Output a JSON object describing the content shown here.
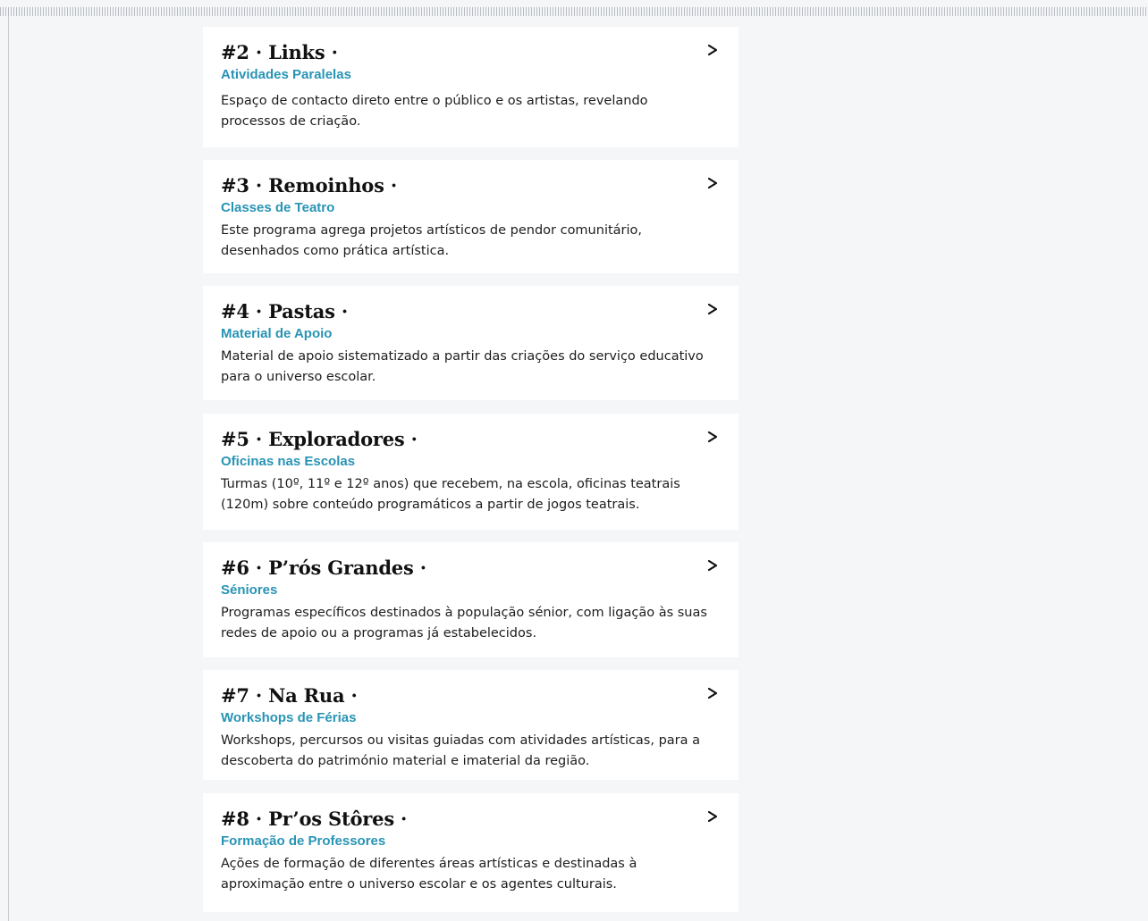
{
  "cards": [
    {
      "title": "#2 · Links ·",
      "subtitle": "Atividades Paralelas",
      "description": "Espaço de contacto direto entre o público e os artistas, revelando processos de criação."
    },
    {
      "title": "#3 · Remoinhos ·",
      "subtitle": "Classes de Teatro",
      "description": "Este programa agrega projetos artísticos de pendor comunitário, desenhados como prática artística."
    },
    {
      "title": "#4 · Pastas ·",
      "subtitle": "Material de Apoio",
      "description": "Material de apoio sistematizado a partir das criações do serviço educativo para o universo escolar."
    },
    {
      "title": "#5 · Exploradores ·",
      "subtitle": "Oficinas nas Escolas",
      "description": "Turmas (10º, 11º e 12º anos) que recebem, na escola, oficinas teatrais (120m) sobre conteúdo programáticos a partir de jogos teatrais."
    },
    {
      "title": "#6 · P’rós Grandes ·",
      "subtitle": "Séniores",
      "description": "Programas específicos destinados à população sénior, com ligação às suas redes de apoio ou a programas já estabelecidos."
    },
    {
      "title": "#7 · Na Rua ·",
      "subtitle": "Workshops de Férias",
      "description": "Workshops, percursos ou visitas guiadas com atividades artísticas, para a descoberta do património material e imaterial da região."
    },
    {
      "title": "#8 · Pr’os Stôres ·",
      "subtitle": "Formação de Professores",
      "description": "Ações de formação de diferentes áreas artísticas e destinadas à aproximação entre o universo escolar e os agentes culturais."
    }
  ],
  "arrow_icon": "chevron-right-icon",
  "colors": {
    "background": "#f5f6f8",
    "card": "#ffffff",
    "accent": "#2894b4",
    "title": "#111111"
  }
}
